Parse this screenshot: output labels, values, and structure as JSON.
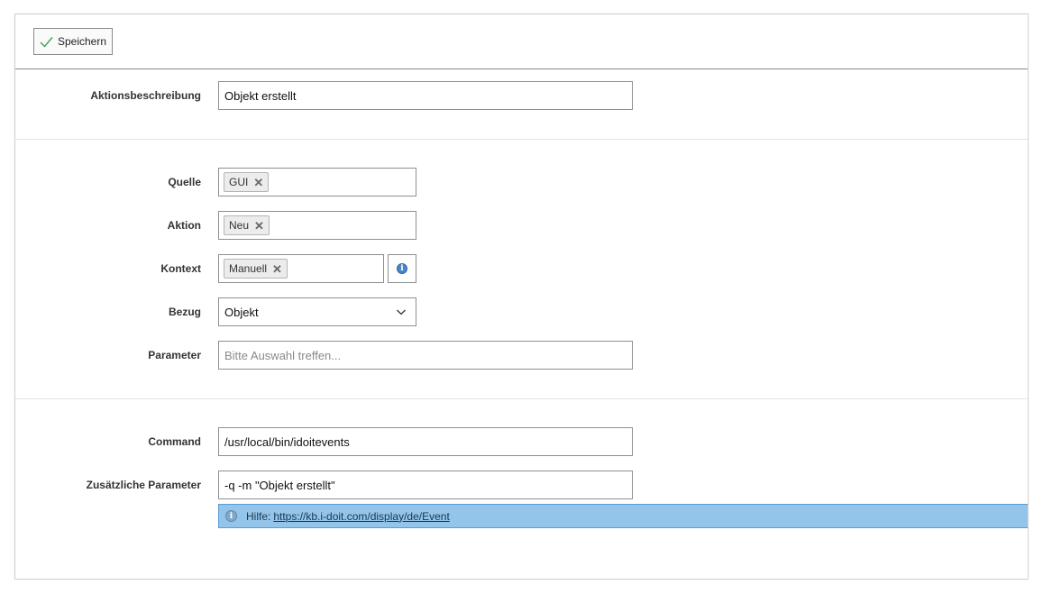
{
  "toolbar": {
    "save_label": "Speichern"
  },
  "form": {
    "description": {
      "label": "Aktionsbeschreibung",
      "value": "Objekt erstellt"
    },
    "source": {
      "label": "Quelle",
      "chip": "GUI"
    },
    "action": {
      "label": "Aktion",
      "chip": "Neu"
    },
    "context": {
      "label": "Kontext",
      "chip": "Manuell"
    },
    "reference": {
      "label": "Bezug",
      "value": "Objekt"
    },
    "parameter": {
      "label": "Parameter",
      "placeholder": "Bitte Auswahl treffen..."
    },
    "command": {
      "label": "Command",
      "value": "/usr/local/bin/idoitevents"
    },
    "extra_params": {
      "label": "Zusätzliche Parameter",
      "value": "-q -m \"Objekt erstellt\""
    }
  },
  "help": {
    "prefix": "Hilfe:",
    "link_text": "https://kb.i-doit.com/display/de/Event"
  },
  "icons": {
    "save": "checkmark-icon",
    "remove": "close-icon",
    "info": "info-icon",
    "dropdown": "chevron-down-icon"
  },
  "colors": {
    "help_bar_bg": "#93c5ea",
    "checkmark": "#3aa35b"
  }
}
